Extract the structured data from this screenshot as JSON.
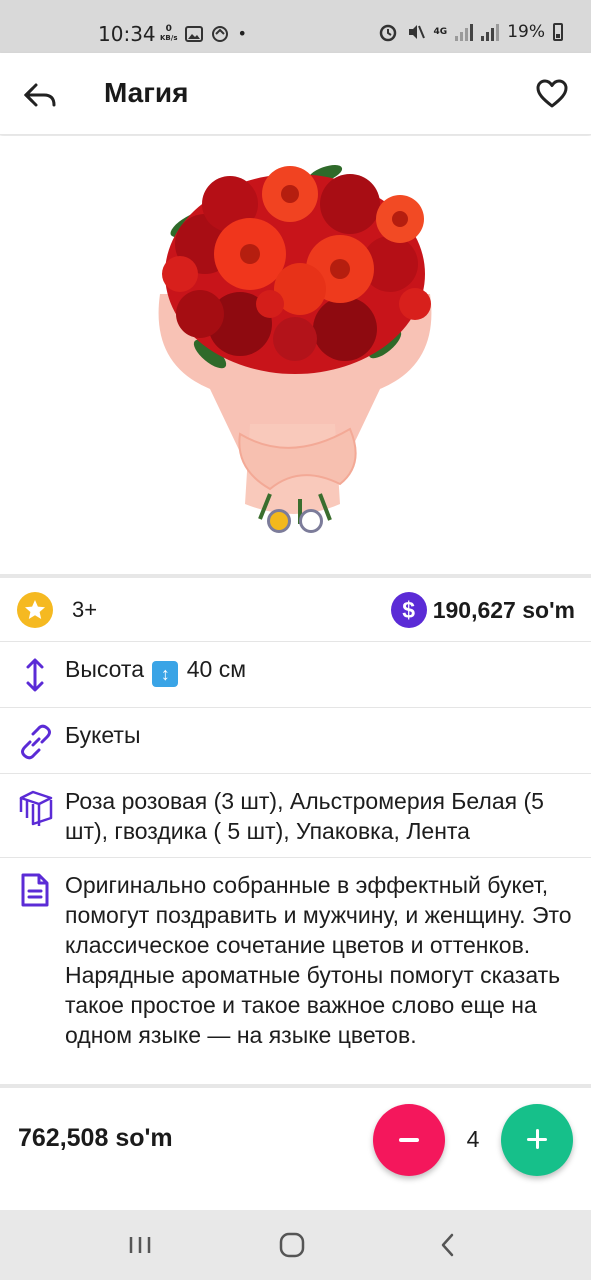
{
  "status_bar": {
    "time": "10:34",
    "net_speed_value": "0",
    "net_speed_unit": "KB/s",
    "network_type": "4G",
    "battery": "19%"
  },
  "app_bar": {
    "title": "Магия"
  },
  "gallery": {
    "image": "red-bouquet-image",
    "slides_count": 2,
    "active_slide": 1
  },
  "details": {
    "rating": "3+",
    "price": "190,627 so'm",
    "height_label": "Высота",
    "height_value": "40 см",
    "category": "Букеты",
    "composition": "Роза розовая (3 шт), Альстромерия Белая (5 шт), гвоздика ( 5 шт), Упаковка, Лента",
    "description": "Оригинально собранные в эффектный букет, помогут поздравить и мужчину, и женщину. Это классическое сочетание цветов и оттенков. Нарядные ароматные бутоны помогут сказать такое простое и такое важное слово еще на одном языке — на языке цветов."
  },
  "cart": {
    "total": "762,508 so'm",
    "quantity": "4"
  },
  "colors": {
    "accent_purple": "#5b2bd6",
    "star_yellow": "#f5b921",
    "minus_red": "#f4175c",
    "plus_green": "#16c08a"
  }
}
